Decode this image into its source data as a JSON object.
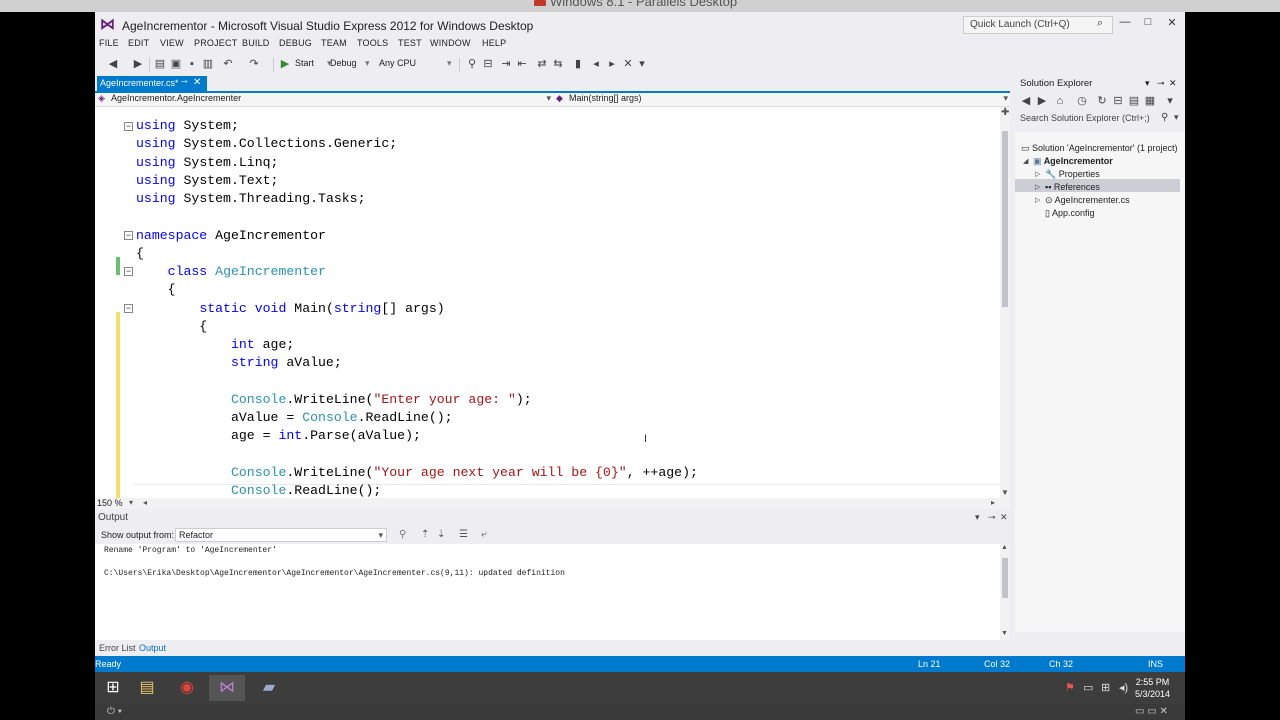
{
  "host": {
    "title": "Windows 8.1 - Parallels Desktop"
  },
  "window": {
    "title": "AgeIncrementor - Microsoft Visual Studio Express 2012 for Windows Desktop",
    "quick_launch_placeholder": "Quick Launch (Ctrl+Q)",
    "controls": {
      "minimize": "—",
      "maximize": "□",
      "close": "✕"
    }
  },
  "menu": [
    "FILE",
    "EDIT",
    "VIEW",
    "PROJECT",
    "BUILD",
    "DEBUG",
    "TEAM",
    "TOOLS",
    "TEST",
    "WINDOW",
    "HELP"
  ],
  "toolbar": {
    "start_label": "Start",
    "config": "Debug",
    "platform": "Any CPU"
  },
  "document": {
    "tab_label": "AgeIncrementer.cs*",
    "nav_class": "AgeIncrementor.AgeIncrementer",
    "nav_member": "Main(string[] args)",
    "zoom": "150 %",
    "code": [
      [
        {
          "t": "using",
          "c": "kw"
        },
        {
          "t": " System;"
        }
      ],
      [
        {
          "t": "using",
          "c": "kw"
        },
        {
          "t": " System.Collections.Generic;"
        }
      ],
      [
        {
          "t": "using",
          "c": "kw"
        },
        {
          "t": " System.Linq;"
        }
      ],
      [
        {
          "t": "using",
          "c": "kw"
        },
        {
          "t": " System.Text;"
        }
      ],
      [
        {
          "t": "using",
          "c": "kw"
        },
        {
          "t": " System.Threading.Tasks;"
        }
      ],
      [],
      [
        {
          "t": "namespace",
          "c": "kw"
        },
        {
          "t": " AgeIncrementor"
        }
      ],
      [
        {
          "t": "{"
        }
      ],
      [
        {
          "t": "    "
        },
        {
          "t": "class",
          "c": "kw"
        },
        {
          "t": " "
        },
        {
          "t": "AgeIncrementer",
          "c": "ty"
        }
      ],
      [
        {
          "t": "    {"
        }
      ],
      [
        {
          "t": "        "
        },
        {
          "t": "static",
          "c": "kw"
        },
        {
          "t": " "
        },
        {
          "t": "void",
          "c": "kw"
        },
        {
          "t": " Main("
        },
        {
          "t": "string",
          "c": "kw"
        },
        {
          "t": "[] args)"
        }
      ],
      [
        {
          "t": "        {"
        }
      ],
      [
        {
          "t": "            "
        },
        {
          "t": "int",
          "c": "kw"
        },
        {
          "t": " age;"
        }
      ],
      [
        {
          "t": "            "
        },
        {
          "t": "string",
          "c": "kw"
        },
        {
          "t": " aValue;"
        }
      ],
      [],
      [
        {
          "t": "            "
        },
        {
          "t": "Console",
          "c": "ty"
        },
        {
          "t": ".WriteLine("
        },
        {
          "t": "\"Enter your age: \"",
          "c": "st"
        },
        {
          "t": ");"
        }
      ],
      [
        {
          "t": "            aValue = "
        },
        {
          "t": "Console",
          "c": "ty"
        },
        {
          "t": ".ReadLine();"
        }
      ],
      [
        {
          "t": "            age = "
        },
        {
          "t": "int",
          "c": "kw"
        },
        {
          "t": ".Parse(aValue);"
        }
      ],
      [],
      [
        {
          "t": "            "
        },
        {
          "t": "Console",
          "c": "ty"
        },
        {
          "t": ".WriteLine("
        },
        {
          "t": "\"Your age next year will be {0}\"",
          "c": "st"
        },
        {
          "t": ", ++age);"
        }
      ],
      [
        {
          "t": "            "
        },
        {
          "t": "Console",
          "c": "ty"
        },
        {
          "t": ".ReadLine();"
        }
      ]
    ]
  },
  "output": {
    "title": "Output",
    "show_output_from_label": "Show output from:",
    "source": "Refactor",
    "lines": [
      "Rename 'Program' to 'AgeIncrementer'",
      "",
      "C:\\Users\\Erika\\Desktop\\AgeIncrementor\\AgeIncrementor\\AgeIncrementer.cs(9,11): updated definition"
    ],
    "tabs": [
      "Error List",
      "Output"
    ]
  },
  "solution_explorer": {
    "title": "Solution Explorer",
    "search_placeholder": "Search Solution Explorer (Ctrl+;)",
    "solution": "Solution 'AgeIncrementor' (1 project)",
    "project": "AgeIncrementor",
    "items": [
      "Properties",
      "References",
      "AgeIncrementer.cs",
      "App.config"
    ]
  },
  "status": {
    "state": "Ready",
    "line": "Ln 21",
    "col": "Col 32",
    "ch": "Ch 32",
    "mode": "INS"
  },
  "taskbar": {
    "time": "2:55 PM",
    "date": "5/3/2014"
  },
  "colors": {
    "accent": "#007acc",
    "vs_purple": "#68217a",
    "keyword": "#0000ff",
    "type": "#2b91af",
    "string": "#a31515"
  }
}
